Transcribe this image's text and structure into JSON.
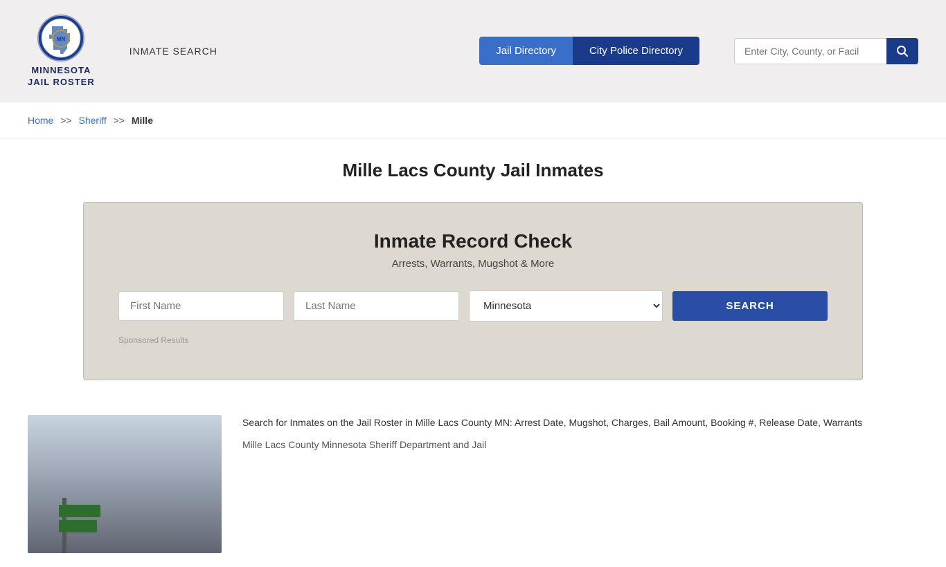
{
  "header": {
    "logo_text_line1": "MINNESOTA",
    "logo_text_line2": "JAIL ROSTER",
    "inmate_search_label": "INMATE SEARCH",
    "nav_jail_label": "Jail Directory",
    "nav_police_label": "City Police Directory",
    "search_placeholder": "Enter City, County, or Facil"
  },
  "breadcrumb": {
    "home_label": "Home",
    "sheriff_label": "Sheriff",
    "current_label": "Mille",
    "sep": ">>"
  },
  "page": {
    "title": "Mille Lacs County Jail Inmates"
  },
  "record_check": {
    "title": "Inmate Record Check",
    "subtitle": "Arrests, Warrants, Mugshot & More",
    "first_name_placeholder": "First Name",
    "last_name_placeholder": "Last Name",
    "state_default": "Minnesota",
    "search_btn_label": "SEARCH",
    "sponsored_label": "Sponsored Results"
  },
  "bottom": {
    "description": "Search for Inmates on the Jail Roster in Mille Lacs County MN: Arrest Date, Mugshot, Charges, Bail Amount, Booking #, Release Date, Warrants",
    "description_2": "Mille Lacs County Minnesota Sheriff Department and Jail"
  }
}
